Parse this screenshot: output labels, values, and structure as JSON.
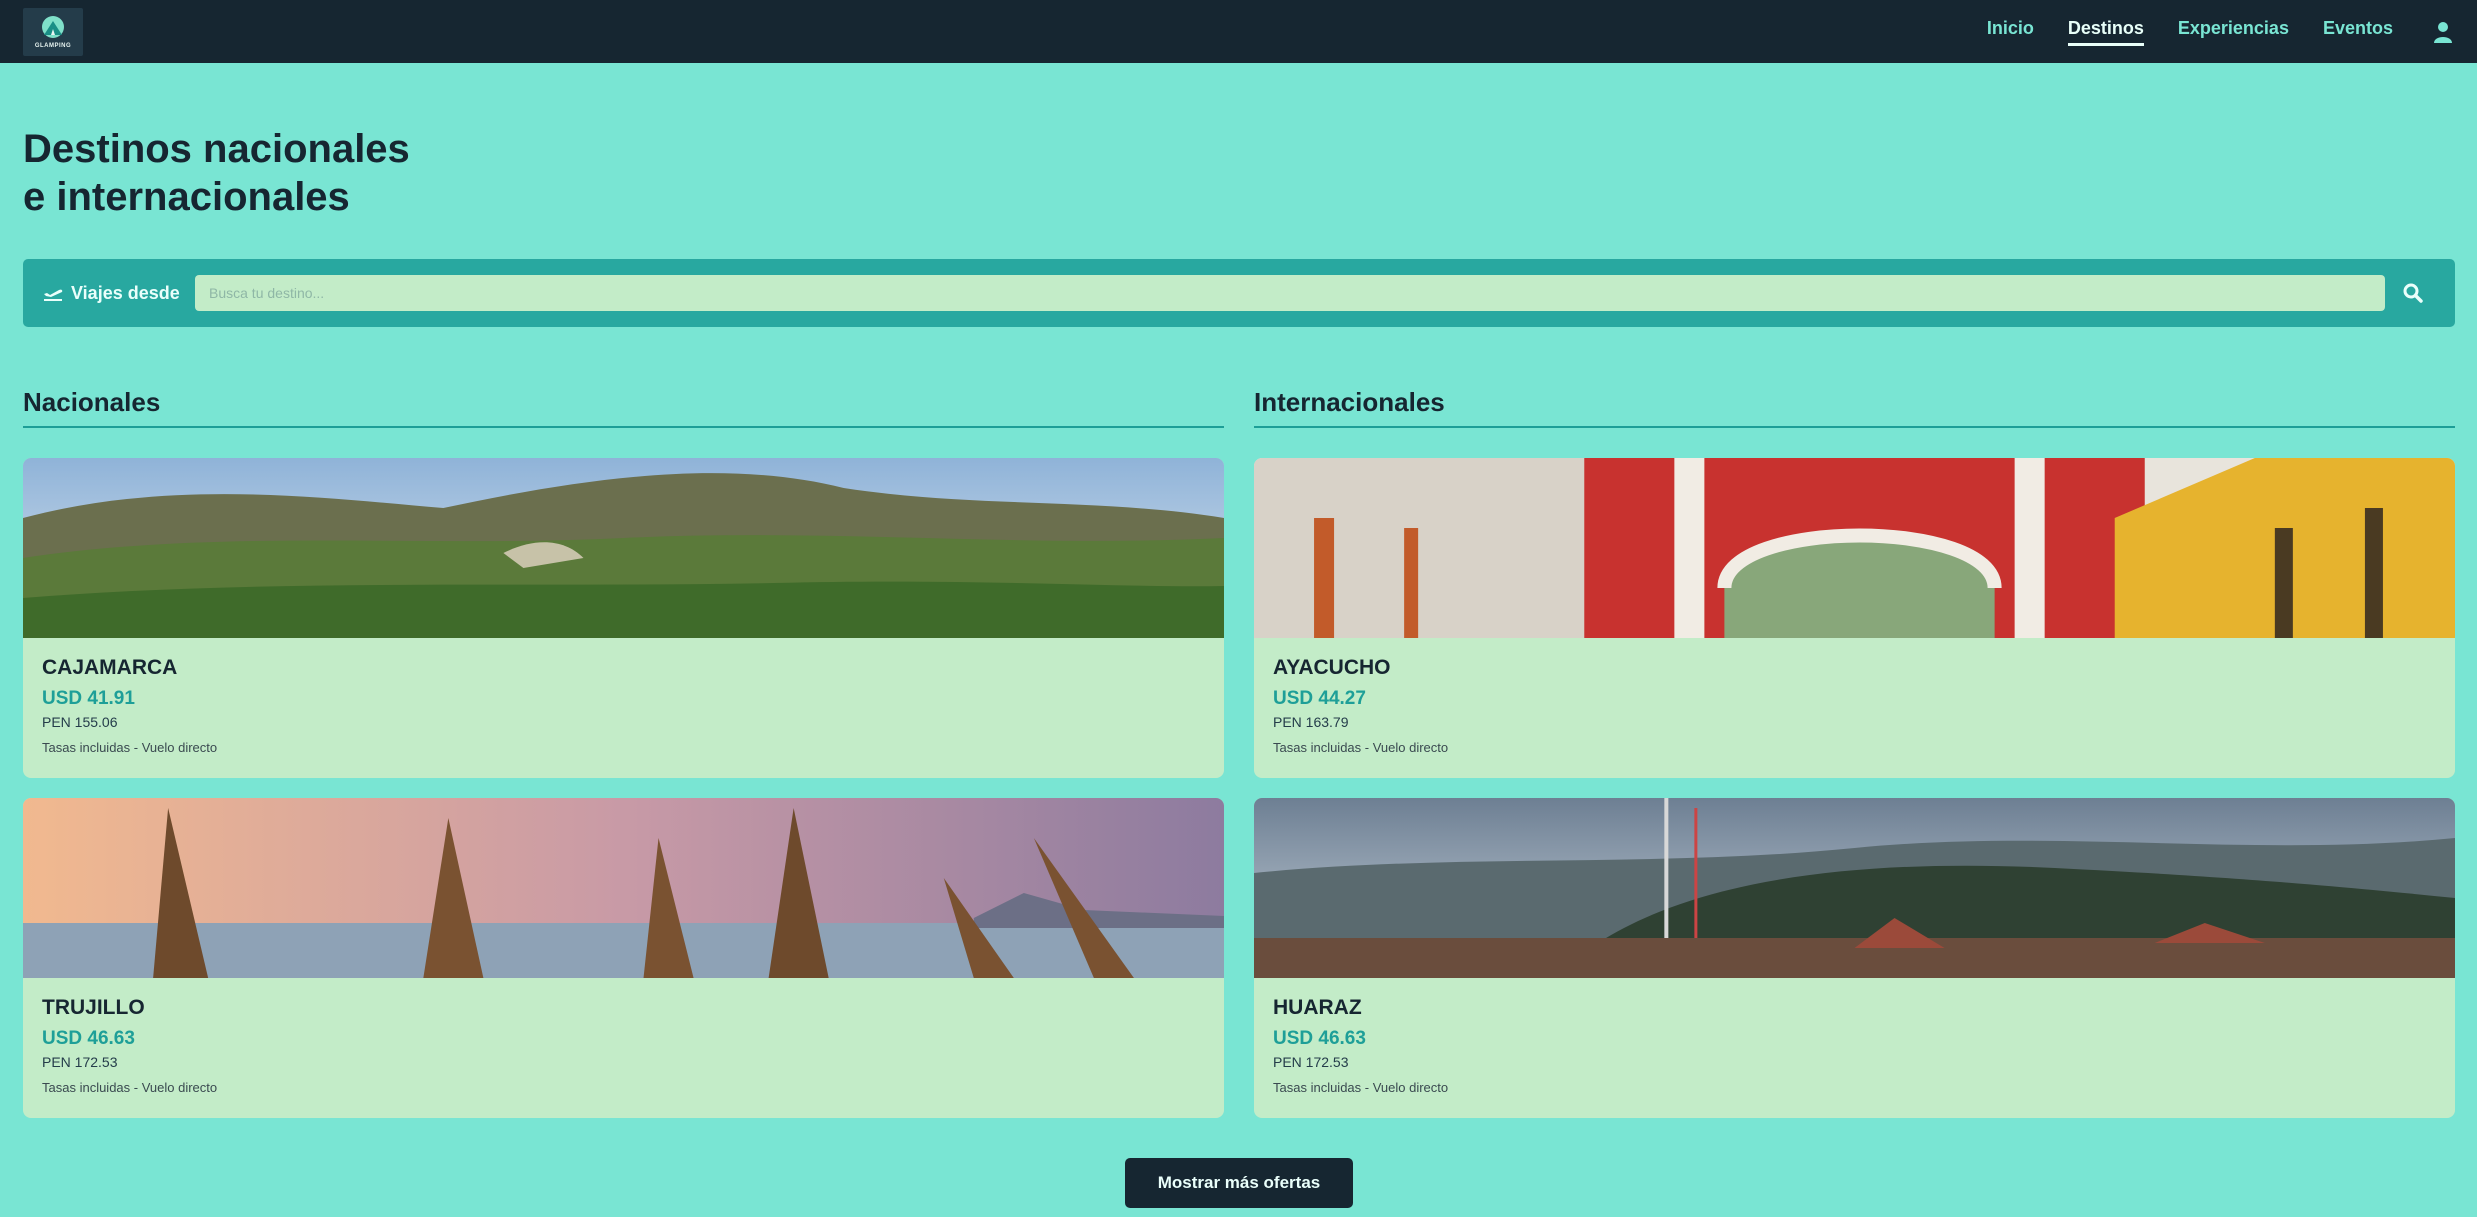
{
  "header": {
    "logo_text": "GLAMPING",
    "nav": [
      {
        "label": "Inicio",
        "active": false
      },
      {
        "label": "Destinos",
        "active": true
      },
      {
        "label": "Experiencias",
        "active": false
      },
      {
        "label": "Eventos",
        "active": false
      }
    ],
    "user_icon": "user-icon"
  },
  "page": {
    "title_line1": "Destinos nacionales",
    "title_line2": "e internacionales"
  },
  "search": {
    "from_label": "Viajes desde",
    "placeholder": "Busca tu destino..."
  },
  "sections": {
    "nacionales": {
      "title": "Nacionales",
      "cards": [
        {
          "name": "CAJAMARCA",
          "usd": "USD 41.91",
          "pen": "PEN 155.06",
          "note": "Tasas incluidas - Vuelo directo"
        },
        {
          "name": "TRUJILLO",
          "usd": "USD 46.63",
          "pen": "PEN 172.53",
          "note": "Tasas incluidas - Vuelo directo"
        }
      ]
    },
    "internacionales": {
      "title": "Internacionales",
      "cards": [
        {
          "name": "AYACUCHO",
          "usd": "USD 44.27",
          "pen": "PEN 163.79",
          "note": "Tasas incluidas - Vuelo directo"
        },
        {
          "name": "HUARAZ",
          "usd": "USD 46.63",
          "pen": "PEN 172.53",
          "note": "Tasas incluidas - Vuelo directo"
        }
      ]
    }
  },
  "more_button": "Mostrar más ofertas",
  "colors": {
    "background": "#79e5d3",
    "header": "#162631",
    "accent": "#1e9f98",
    "card": "#c3ecc8"
  }
}
